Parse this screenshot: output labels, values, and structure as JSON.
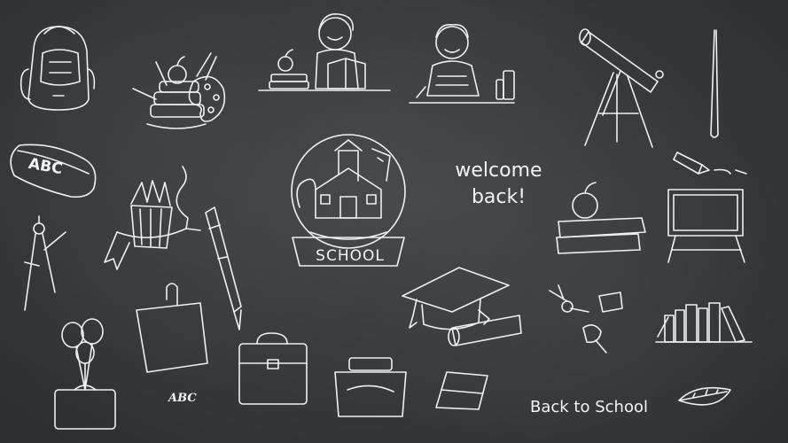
{
  "greeting": {
    "line1": "welcome",
    "line2": "back!"
  },
  "footer_title": "Back to School",
  "globe_label": "SCHOOL",
  "pencil_case_label": "ABC",
  "small_caption": "ABC",
  "colors": {
    "chalkboard": "#383c3f",
    "chalk": "#eef0f1"
  },
  "icons": [
    "backpack-icon",
    "books-stack-icon",
    "paint-palette-icon",
    "apple-icon",
    "girl-reading-icon",
    "boy-writing-icon",
    "telescope-icon",
    "pointer-stick-icon",
    "pencil-case-icon",
    "colored-pencils-icon",
    "ribbon-banner-icon",
    "snow-globe-school-icon",
    "fountain-pen-icon",
    "compass-tool-icon",
    "crayon-icon",
    "apple-on-books-icon",
    "blackboard-easel-icon",
    "paper-note-icon",
    "paper-clip-icon",
    "briefcase-icon",
    "graduation-cap-icon",
    "diploma-scroll-icon",
    "push-pins-icon",
    "bookshelf-books-icon",
    "balloons-bag-icon",
    "ink-bottle-icon",
    "notebook-icon",
    "leaf-icon"
  ]
}
